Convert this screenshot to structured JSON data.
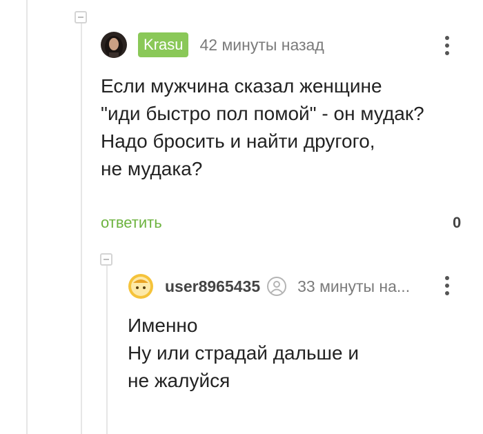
{
  "comment1": {
    "author": "Krasu",
    "time": "42 минуты назад",
    "lines": [
      "Если мужчина сказал женщине",
      "\"иди быстро пол помой\" - он мудак?",
      "Надо бросить и найти другого,",
      "не мудака?"
    ],
    "reply_label": "ответить",
    "rating": "0"
  },
  "comment2": {
    "author": "user8965435",
    "time": "33 минуты на...",
    "lines": [
      "Именно",
      "Ну или страдай дальше и",
      "не жалуйся"
    ]
  },
  "icons": {
    "collapse": "collapse-toggle-icon",
    "more": "more-vertical-icon",
    "user": "user-circle-icon"
  },
  "colors": {
    "author_badge": "#8ac858",
    "reply_link": "#6db33f",
    "thread_line": "#e6e6e6"
  }
}
